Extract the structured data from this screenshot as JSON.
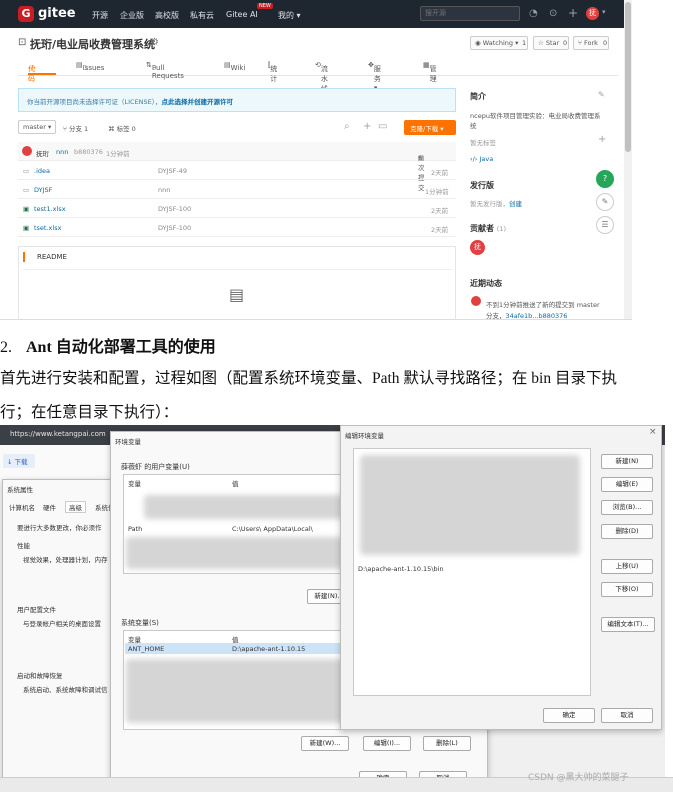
{
  "gitee": {
    "nav": {
      "logo_letter": "G",
      "logo_text": "gitee",
      "items": [
        "开源",
        "企业版",
        "高校版",
        "私有云",
        "Gitee AI",
        "我的 ▾"
      ],
      "new_badge": "NEW",
      "search_placeholder": "搜开源",
      "avatar_letter": "抚"
    },
    "repo": {
      "title": "抚珩/电业局收费管理系统",
      "watch_label": "Watching ▾",
      "watch_count": "1",
      "star_label": "Star",
      "star_count": "0",
      "fork_label": "Fork",
      "fork_count": "0"
    },
    "tabs": [
      "代码",
      "Issues",
      "0",
      "Pull Requests",
      "0",
      "Wiki",
      "统计",
      "流水线",
      "服务 ▾",
      "管理"
    ],
    "notice_text": "你当前开源项目尚未选择许可证（LICENSE），",
    "notice_link": "点此选择并创建开源许可",
    "toolbar": {
      "branch": "master ▾",
      "branches": "分支 1",
      "tags": "标签 0",
      "clone": "克隆/下载 ▾"
    },
    "commit": {
      "author": "抚珩",
      "user": "nnn",
      "hash": "b880376",
      "time": "1分钟前",
      "count": "6 次提交"
    },
    "files": [
      {
        "name": ".idea",
        "message": "DYJSF-49",
        "time": "2天前"
      },
      {
        "name": "DYJSF",
        "message": "nnn",
        "time": "1分钟前"
      },
      {
        "name": "test1.xlsx",
        "message": "DYJSF-100",
        "time": "2天前"
      },
      {
        "name": "tset.xlsx",
        "message": "DYJSF-100",
        "time": "2天前"
      }
    ],
    "readme_label": "README",
    "sidebar": {
      "intro_title": "简介",
      "intro_text_1": "ncepu软件项目管理实验：电业局收费管理系",
      "intro_text_2": "统",
      "no_tag": "暂无标签",
      "lang": "Java",
      "release_title": "发行版",
      "no_release": "暂无发行版，",
      "create": "创建",
      "contrib_title": "贡献者",
      "contrib_count": "(1)",
      "contrib_avatar": "抚",
      "activity_title": "近期动态",
      "activity_1": "不到1分钟前推送了新的提交到 master",
      "activity_2": "分支，",
      "activity_link": "34afe1b...b880376"
    }
  },
  "article": {
    "heading_num": "2.",
    "heading": "Ant 自动化部署工具的使用",
    "line1": "首先进行安装和配置，过程如图（配置系统环境变量、Path 默认寻找路径；在 bin 目录下执",
    "line2": "行；在任意目录下执行）："
  },
  "envshot": {
    "browser_url": "https://www.ketangpai.com",
    "download_btn": "↓ 下载",
    "sysprops": {
      "title": "系统属性",
      "tabs": [
        "计算机名",
        "硬件",
        "高级",
        "系统保"
      ],
      "admin_note": "要进行大多数更改，你必须作",
      "perf_title": "性能",
      "perf_text": "视觉效果，处理器计划，内存",
      "profile_title": "用户配置文件",
      "profile_text": "与登录帐户相关的桌面设置",
      "recovery_title": "启动和故障恢复",
      "recovery_text": "系统启动、系统故障和调试信"
    },
    "envvars": {
      "title": "环境变量",
      "user_section": "薛薇虾 的用户变量(U)",
      "col_var": "变量",
      "col_val": "值",
      "user_row_var": "Path",
      "user_row_val": "C:\\Users\\      AppData\\Local\\",
      "new_u": "新建(N)...",
      "sys_section": "系统变量(S)",
      "sys_row_var": "ANT_HOME",
      "sys_row_val": "D:\\apache-ant-1.10.15",
      "new_w": "新建(W)...",
      "edit_i": "编辑(I)...",
      "delete_l": "删除(L)",
      "ok": "确定",
      "cancel": "取消"
    },
    "editenv": {
      "title": "编辑环境变量",
      "entry": "D:\\apache-ant-1.10.15\\bin",
      "buttons": [
        "新建(N)",
        "编辑(E)",
        "浏览(B)...",
        "删除(D)",
        "上移(U)",
        "下移(O)",
        "编辑文本(T)..."
      ],
      "ok": "确定",
      "cancel": "取消"
    },
    "watermark": "CSDN @黑大帅的菜腿子"
  }
}
